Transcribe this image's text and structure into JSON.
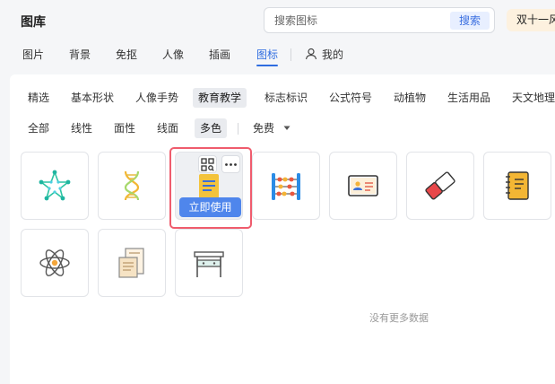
{
  "header": {
    "title": "图库",
    "search": {
      "placeholder": "搜索图标",
      "button_label": "搜索"
    },
    "promo_label": "双十一风"
  },
  "main_tabs": [
    {
      "label": "图片",
      "active": false
    },
    {
      "label": "背景",
      "active": false
    },
    {
      "label": "免抠",
      "active": false
    },
    {
      "label": "人像",
      "active": false
    },
    {
      "label": "插画",
      "active": false
    },
    {
      "label": "图标",
      "active": true
    }
  ],
  "my_tab": {
    "label": "我的",
    "icon": "user-icon"
  },
  "categories": [
    {
      "label": "精选",
      "active": false
    },
    {
      "label": "基本形状",
      "active": false
    },
    {
      "label": "人像手势",
      "active": false
    },
    {
      "label": "教育教学",
      "active": true
    },
    {
      "label": "标志标识",
      "active": false
    },
    {
      "label": "公式符号",
      "active": false
    },
    {
      "label": "动植物",
      "active": false
    },
    {
      "label": "生活用品",
      "active": false
    },
    {
      "label": "天文地理",
      "active": false
    }
  ],
  "styles": [
    {
      "label": "全部",
      "active": false
    },
    {
      "label": "线性",
      "active": false
    },
    {
      "label": "面性",
      "active": false
    },
    {
      "label": "线面",
      "active": false
    },
    {
      "label": "多色",
      "active": true
    }
  ],
  "price_filter": {
    "label": "免费",
    "icon": "caret-down-icon"
  },
  "icons": [
    {
      "name": "constellation-star-icon"
    },
    {
      "name": "dna-helix-icon"
    },
    {
      "name": "document-board-icon"
    },
    {
      "name": "abacus-icon"
    },
    {
      "name": "id-card-icon"
    },
    {
      "name": "eraser-icon"
    },
    {
      "name": "notebook-icon"
    },
    {
      "name": "atom-icon"
    },
    {
      "name": "scroll-paper-icon"
    },
    {
      "name": "desk-icon"
    }
  ],
  "hover_card": {
    "use_button_label": "立即使用",
    "grid_icon": "grid-view-icon",
    "more_icon": "more-icon"
  },
  "empty_message": "没有更多数据",
  "colors": {
    "accent": "#2f6de0",
    "button": "#4f86ec",
    "hover_border": "#ef5c6d"
  }
}
